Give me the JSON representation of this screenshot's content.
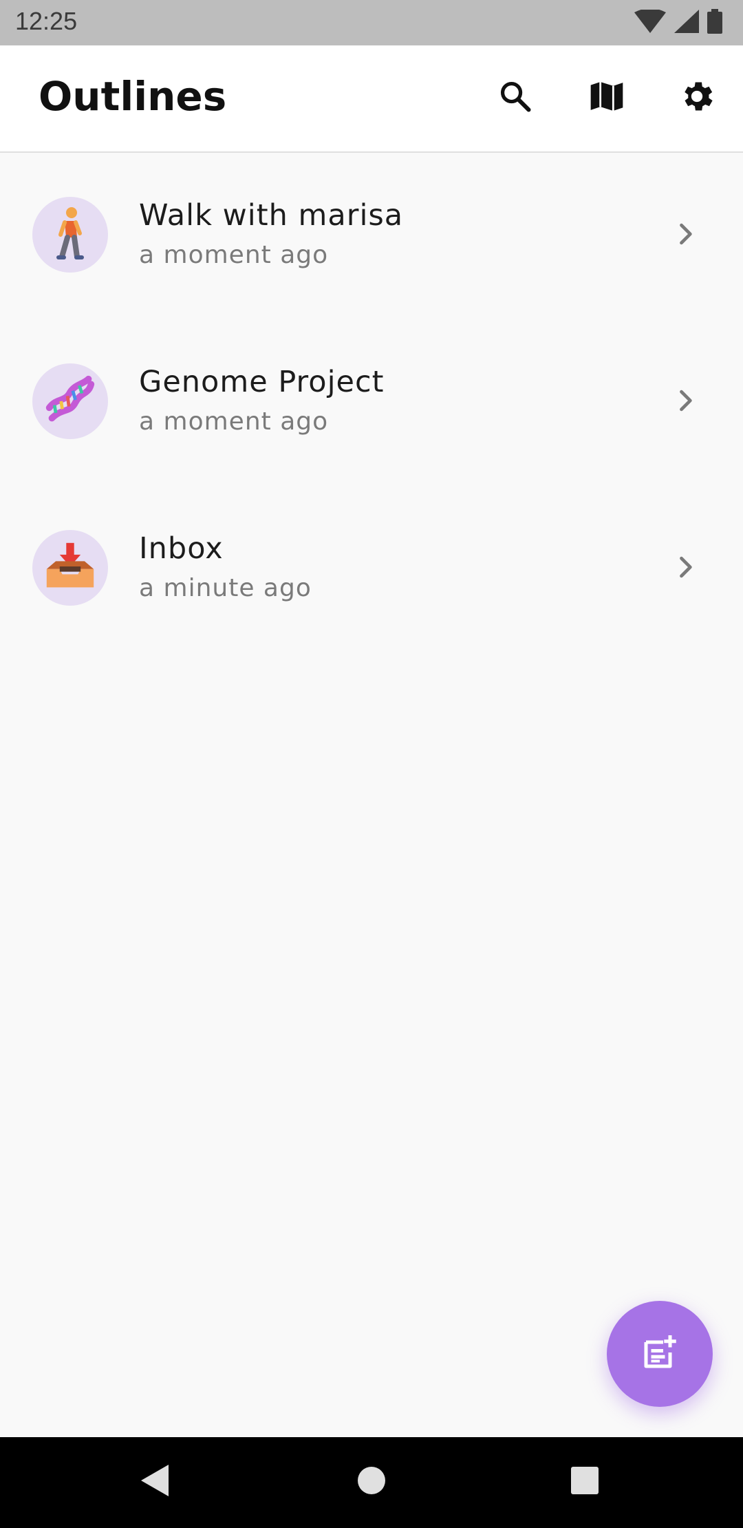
{
  "status_bar": {
    "time": "12:25",
    "icons": [
      "wifi-icon",
      "signal-icon",
      "battery-icon"
    ]
  },
  "app_bar": {
    "title": "Outlines",
    "actions": [
      "search-icon",
      "map-icon",
      "gear-icon"
    ]
  },
  "outlines": [
    {
      "title": "Walk with marisa",
      "subtitle": "a moment ago",
      "icon": "person-walking-icon"
    },
    {
      "title": "Genome Project",
      "subtitle": "a moment ago",
      "icon": "dna-icon"
    },
    {
      "title": "Inbox",
      "subtitle": "a minute ago",
      "icon": "inbox-tray-icon"
    }
  ],
  "fab": {
    "icon": "note-add-icon"
  },
  "nav_bar": {
    "buttons": [
      "back-icon",
      "home-icon",
      "recents-icon"
    ]
  },
  "colors": {
    "accent": "#a673e6",
    "avatar_bg": "#e6ddf3",
    "background": "#f9f9f9",
    "status_bar": "#bdbdbd"
  }
}
